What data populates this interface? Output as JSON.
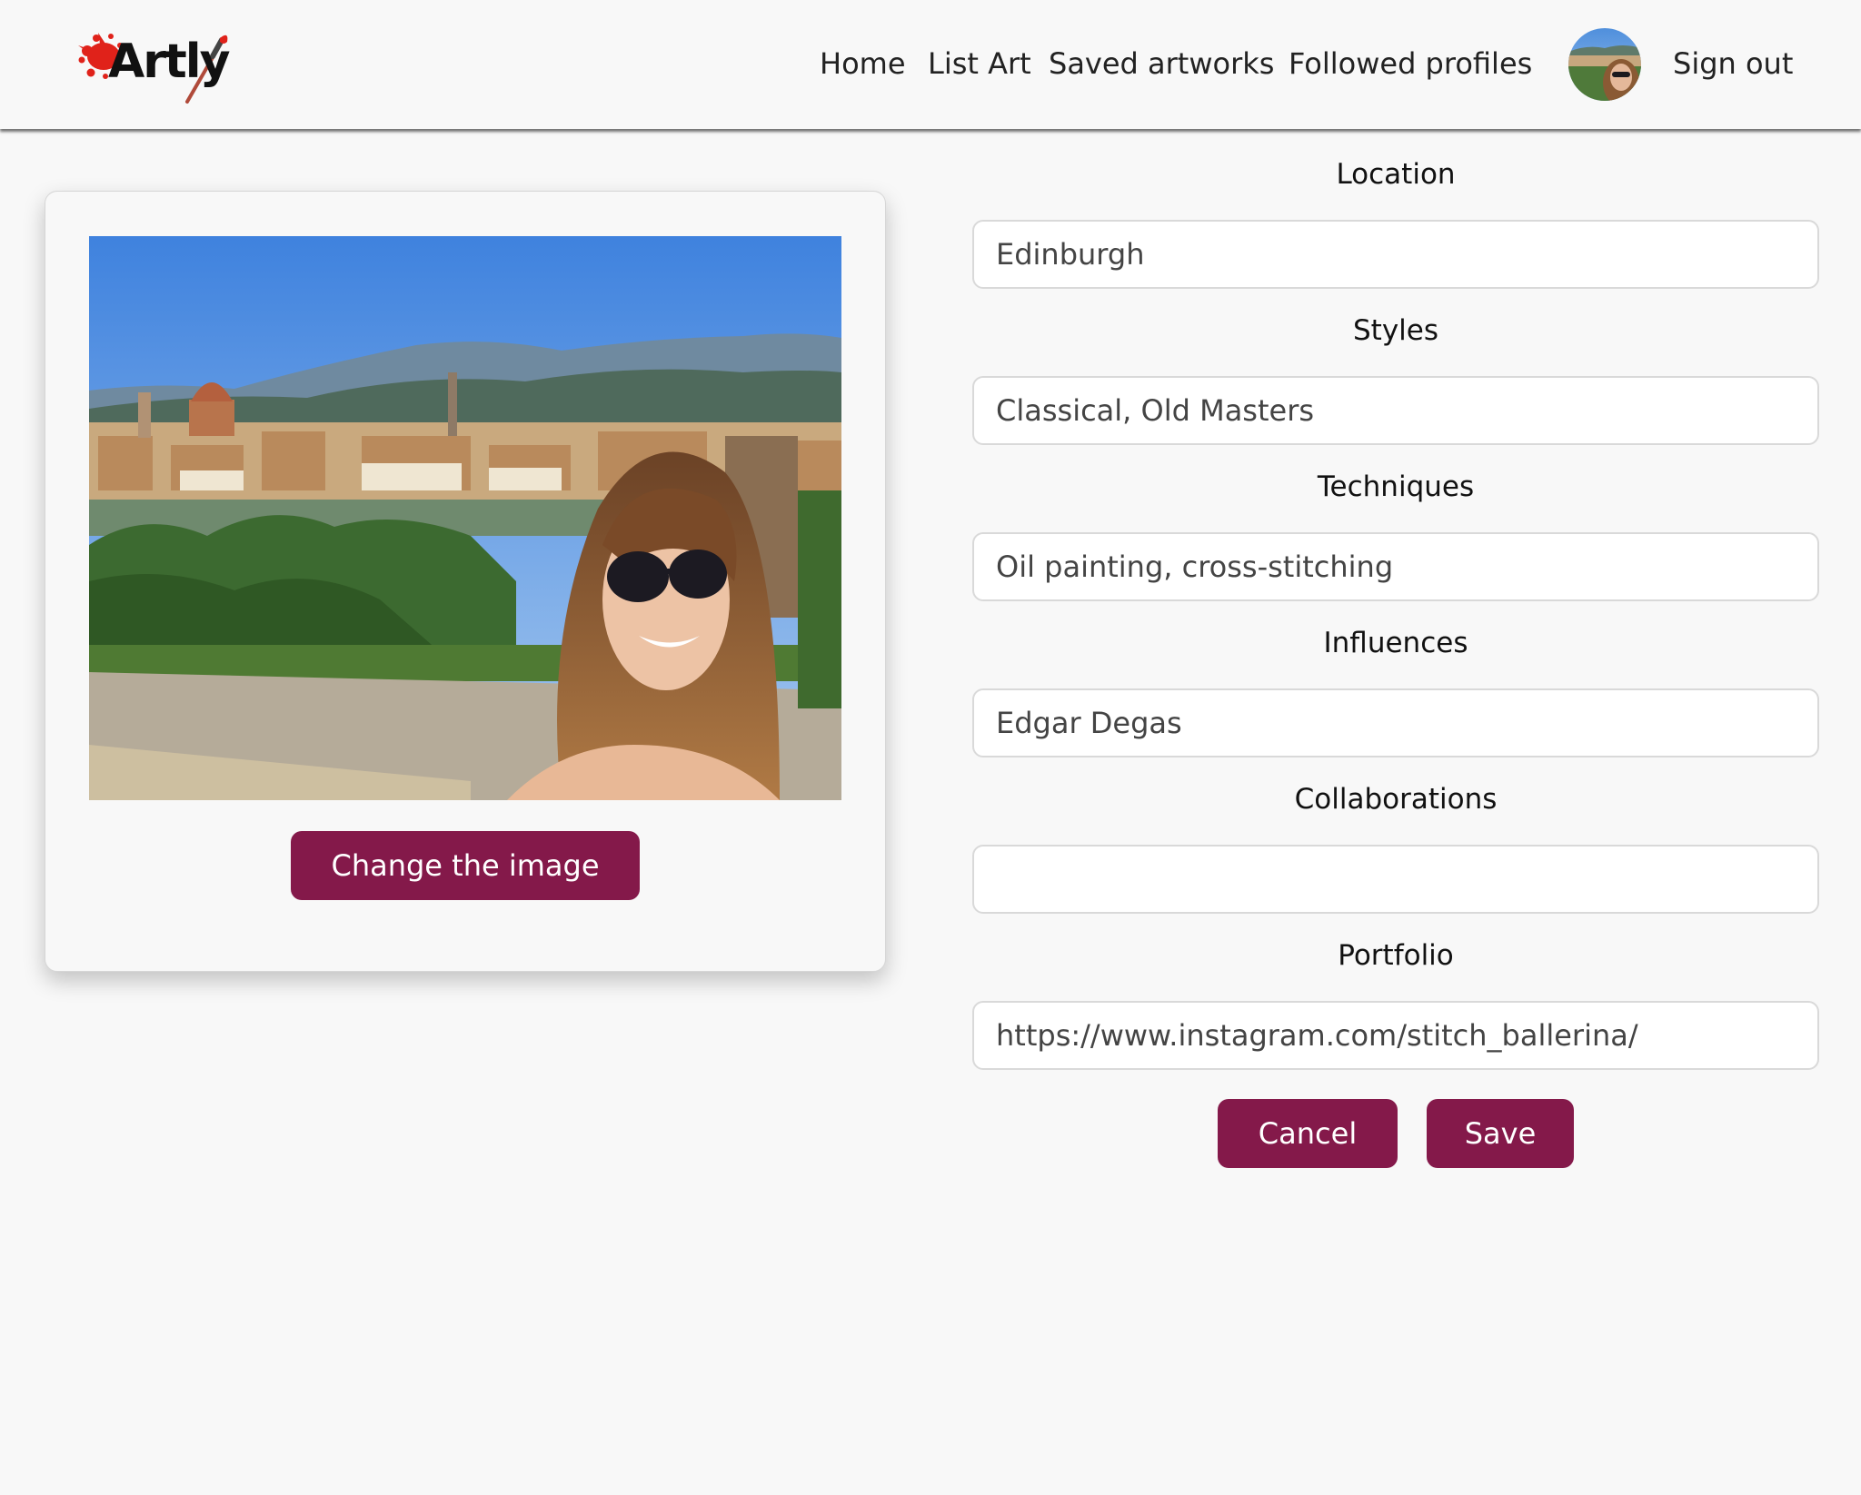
{
  "brand": {
    "logo_text": "Artly",
    "colors": {
      "accent": "#84194a",
      "logo_splash": "#e0221a",
      "background": "#f8f8f8"
    }
  },
  "nav": {
    "links": [
      {
        "label": "Home"
      },
      {
        "label": "List Art"
      },
      {
        "label": "Saved artworks"
      },
      {
        "label": "Followed profiles"
      }
    ],
    "sign_out": "Sign out",
    "avatar_icon": "user-avatar"
  },
  "image_card": {
    "change_button": "Change the image"
  },
  "form": {
    "fields": [
      {
        "label": "Location",
        "value": "Edinburgh"
      },
      {
        "label": "Styles",
        "value": "Classical, Old Masters"
      },
      {
        "label": "Techniques",
        "value": "Oil painting, cross-stitching"
      },
      {
        "label": "Influences",
        "value": "Edgar Degas"
      },
      {
        "label": "Collaborations",
        "value": ""
      },
      {
        "label": "Portfolio",
        "value": "https://www.instagram.com/stitch_ballerina/"
      }
    ],
    "cancel_button": "Cancel",
    "save_button": "Save"
  }
}
